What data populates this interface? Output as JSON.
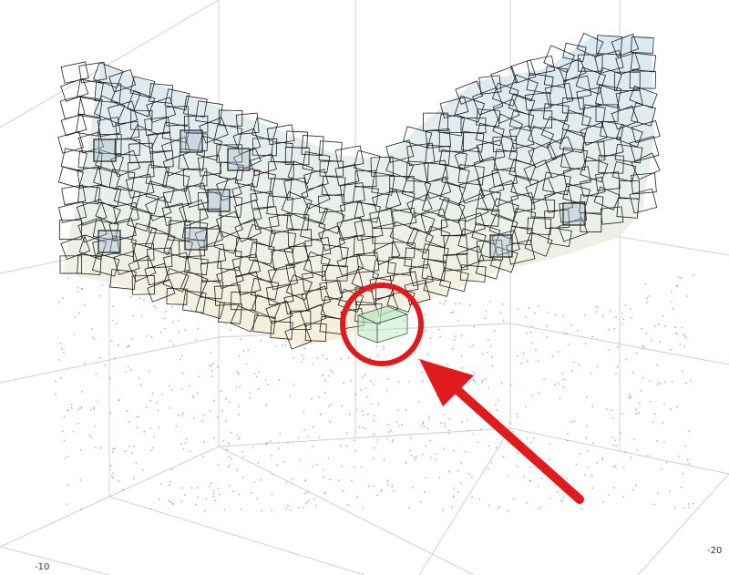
{
  "axes": {
    "tick_labels": {
      "left": "-10",
      "right": "-20"
    }
  },
  "colors": {
    "background": "#ffffff",
    "grid": "#d0d0d0",
    "surface_top": "#d6e6f2",
    "surface_bottom": "#f6eed6",
    "mesh_line": "#1e1e1e",
    "points": "#4a90c8",
    "highlight_box": "#b8e6c0",
    "annotation": "#e11b1b"
  },
  "icons": {
    "annotation_circle": "red-circle",
    "annotation_arrow": "red-arrow"
  }
}
